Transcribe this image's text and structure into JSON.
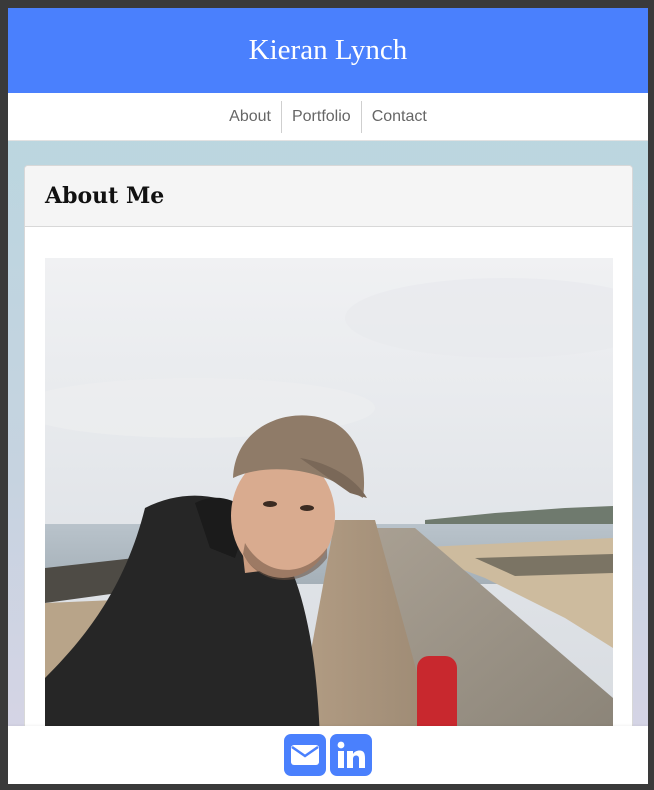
{
  "header": {
    "title": "Kieran Lynch"
  },
  "nav": {
    "items": [
      {
        "label": "About"
      },
      {
        "label": "Portfolio"
      },
      {
        "label": "Contact"
      }
    ]
  },
  "about": {
    "heading": "About Me",
    "photo_icon": "profile-photo"
  },
  "footer": {
    "icons": [
      "envelope-icon",
      "linkedin-icon"
    ]
  },
  "colors": {
    "accent": "#4a80fd",
    "frame": "#3a3a3a"
  }
}
